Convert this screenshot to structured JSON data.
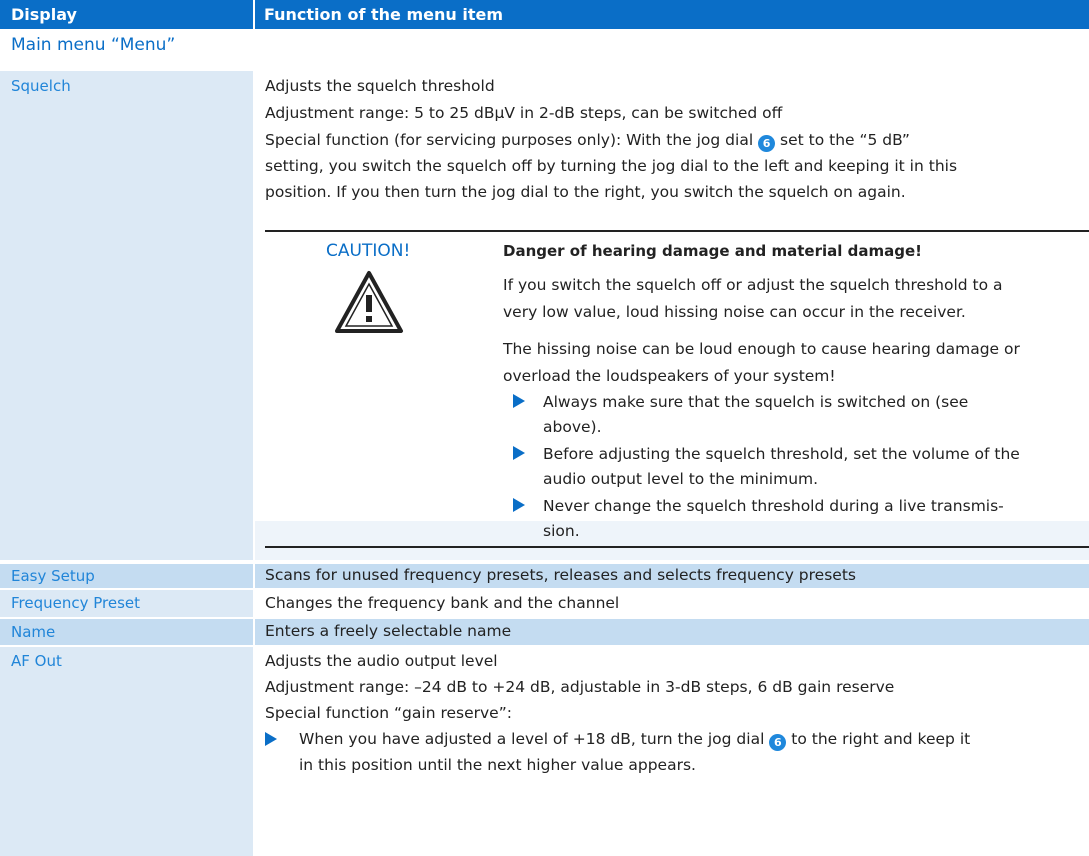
{
  "header": {
    "col1": "Display",
    "col2": "Function of the menu item"
  },
  "section_title": "Main menu “Menu”",
  "squelch": {
    "label": "Squelch",
    "line1": "Adjusts the squelch threshold",
    "line2": "Adjustment range: 5 to 25 dBµV in 2-dB steps, can be switched off",
    "line3a": "Special function (for servicing purposes only): With the jog dial",
    "dial_num": "6",
    "line3b": "set to the “5 dB”",
    "line4": "setting, you switch the squelch off by turning the jog dial to the left and keeping it in this",
    "line5": "position. If you then turn the jog dial to the right, you switch the squelch on again."
  },
  "caution": {
    "word": "CAUTION!",
    "icon": "warning-triangle-icon",
    "heading": "Danger of hearing damage and material damage!",
    "p1a": "If you switch the squelch off or adjust the squelch threshold to a",
    "p1b": "very low value, loud hissing noise can occur in the receiver.",
    "p2a": "The hissing noise can be loud enough to cause hearing damage or",
    "p2b": "overload the loudspeakers of your system!",
    "b1a": "Always make sure that the squelch is switched on (see",
    "b1b": "above).",
    "b2a": "Before adjusting the squelch threshold, set the volume of the",
    "b2b": "audio output level to the minimum.",
    "b3a": "Never change the squelch threshold during a live transmis-",
    "b3b": "sion."
  },
  "rows": {
    "easy_setup": {
      "label": "Easy Setup",
      "text": "Scans for unused frequency presets, releases and selects frequency presets"
    },
    "freq_preset": {
      "label": "Frequency Preset",
      "text": "Changes the frequency bank and the channel"
    },
    "name": {
      "label": "Name",
      "text": "Enters a freely selectable name"
    }
  },
  "af_out": {
    "label": "AF Out",
    "line1": "Adjusts the audio output level",
    "line2": "Adjustment range: –24 dB to +24 dB, adjustable in 3-dB steps, 6 dB gain reserve",
    "line3": "Special function “gain reserve”:",
    "bullet_a": "When you have adjusted a level of +18 dB, turn the jog dial",
    "dial_num": "6",
    "bullet_b": "to the right and keep it",
    "bullet_c": "in this position until the next higher value appears."
  },
  "colors": {
    "header_bg": "#0a6ec7",
    "label_blue": "#2185d8",
    "row_light": "#dce9f5",
    "row_mid": "#c4dcf1"
  }
}
